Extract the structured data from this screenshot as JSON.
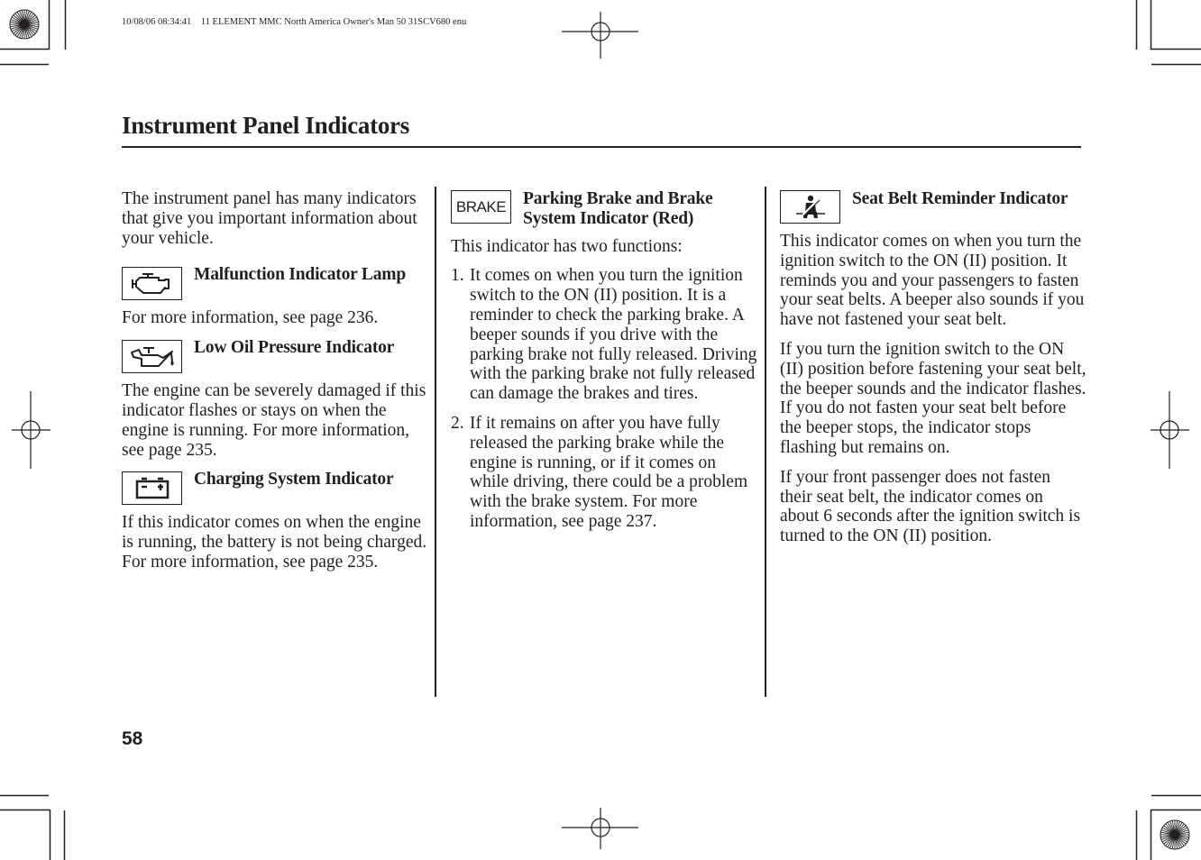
{
  "print_header": "10/08/06 08:34:41    11 ELEMENT MMC North America Owner's Man 50 31SCV680 enu",
  "page": {
    "title": "Instrument Panel Indicators",
    "number": "58"
  },
  "column1": {
    "intro": "The instrument panel has many indicators that give you important information about your vehicle.",
    "sections": [
      {
        "icon": "check-engine-icon",
        "heading": "Malfunction Indicator Lamp",
        "body": "For more information, see page 236."
      },
      {
        "icon": "oil-can-icon",
        "heading": "Low Oil Pressure Indicator",
        "body": "The engine can be severely damaged if this indicator flashes or stays on when the engine is running. For more information, see page 235."
      },
      {
        "icon": "battery-icon",
        "heading": "Charging System Indicator",
        "body": "If this indicator comes on when the engine is running, the battery is not being charged. For more information, see page 235."
      }
    ]
  },
  "column2": {
    "icon": "brake-icon",
    "icon_label": "BRAKE",
    "heading": "Parking Brake and Brake System Indicator (Red)",
    "intro": "This indicator has two functions:",
    "items": [
      {
        "num": "1.",
        "text": "It comes on when you turn the ignition switch to the ON (II) position. It is a reminder to check the parking brake. A beeper sounds if you drive with the parking brake not fully released. Driving with the parking brake not fully released can damage the brakes and tires."
      },
      {
        "num": "2.",
        "text": "If it remains on after you have fully released the parking brake while the engine is running, or if it comes on while driving, there could be a problem with the brake system. For more information, see page 237."
      }
    ]
  },
  "column3": {
    "icon": "seat-belt-icon",
    "heading": "Seat Belt Reminder Indicator",
    "paragraphs": [
      "This indicator comes on when you turn the ignition switch to the ON (II) position. It reminds you and your passengers to fasten your seat belts. A beeper also sounds if you have not fastened your seat belt.",
      "If you turn the ignition switch to the ON (II) position before fastening your seat belt, the beeper sounds and the indicator flashes. If you do not fasten your seat belt before the beeper stops, the indicator stops flashing but remains on.",
      "If your front passenger does not fasten their seat belt, the indicator comes on about 6 seconds after the ignition switch is turned to the ON (II) position."
    ]
  }
}
